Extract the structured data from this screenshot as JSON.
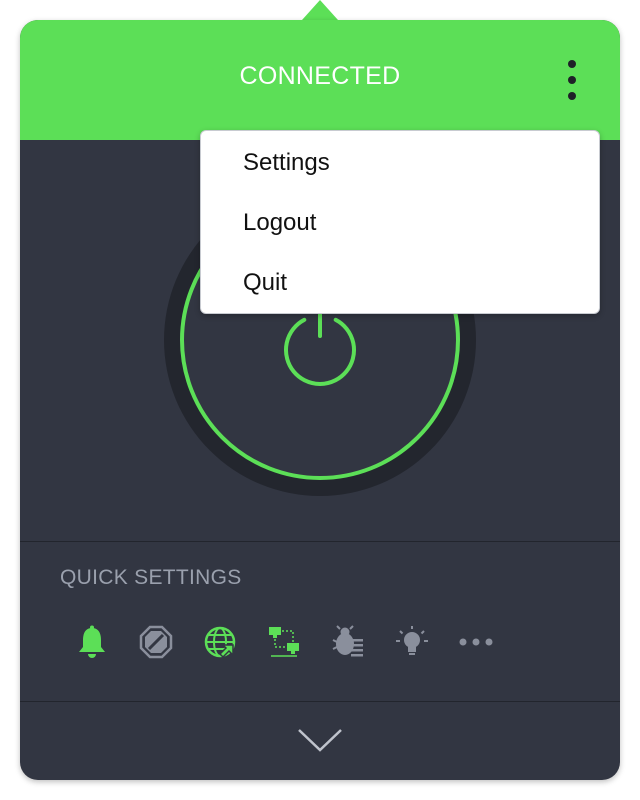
{
  "header": {
    "status": "CONNECTED",
    "color": "#5cdf57"
  },
  "menu": {
    "items": [
      {
        "label": "Settings"
      },
      {
        "label": "Logout"
      },
      {
        "label": "Quit"
      }
    ]
  },
  "quick_settings": {
    "title": "QUICK SETTINGS",
    "icons": [
      {
        "name": "bell-icon",
        "active": true
      },
      {
        "name": "block-icon",
        "active": false
      },
      {
        "name": "globe-icon",
        "active": true
      },
      {
        "name": "network-icon",
        "active": true
      },
      {
        "name": "bug-icon",
        "active": false
      },
      {
        "name": "lightbulb-icon",
        "active": false
      },
      {
        "name": "more-icon",
        "active": false
      }
    ]
  },
  "colors": {
    "accent": "#5cdf57",
    "panel_bg": "#323642",
    "inactive_icon": "#8a8f9c"
  }
}
